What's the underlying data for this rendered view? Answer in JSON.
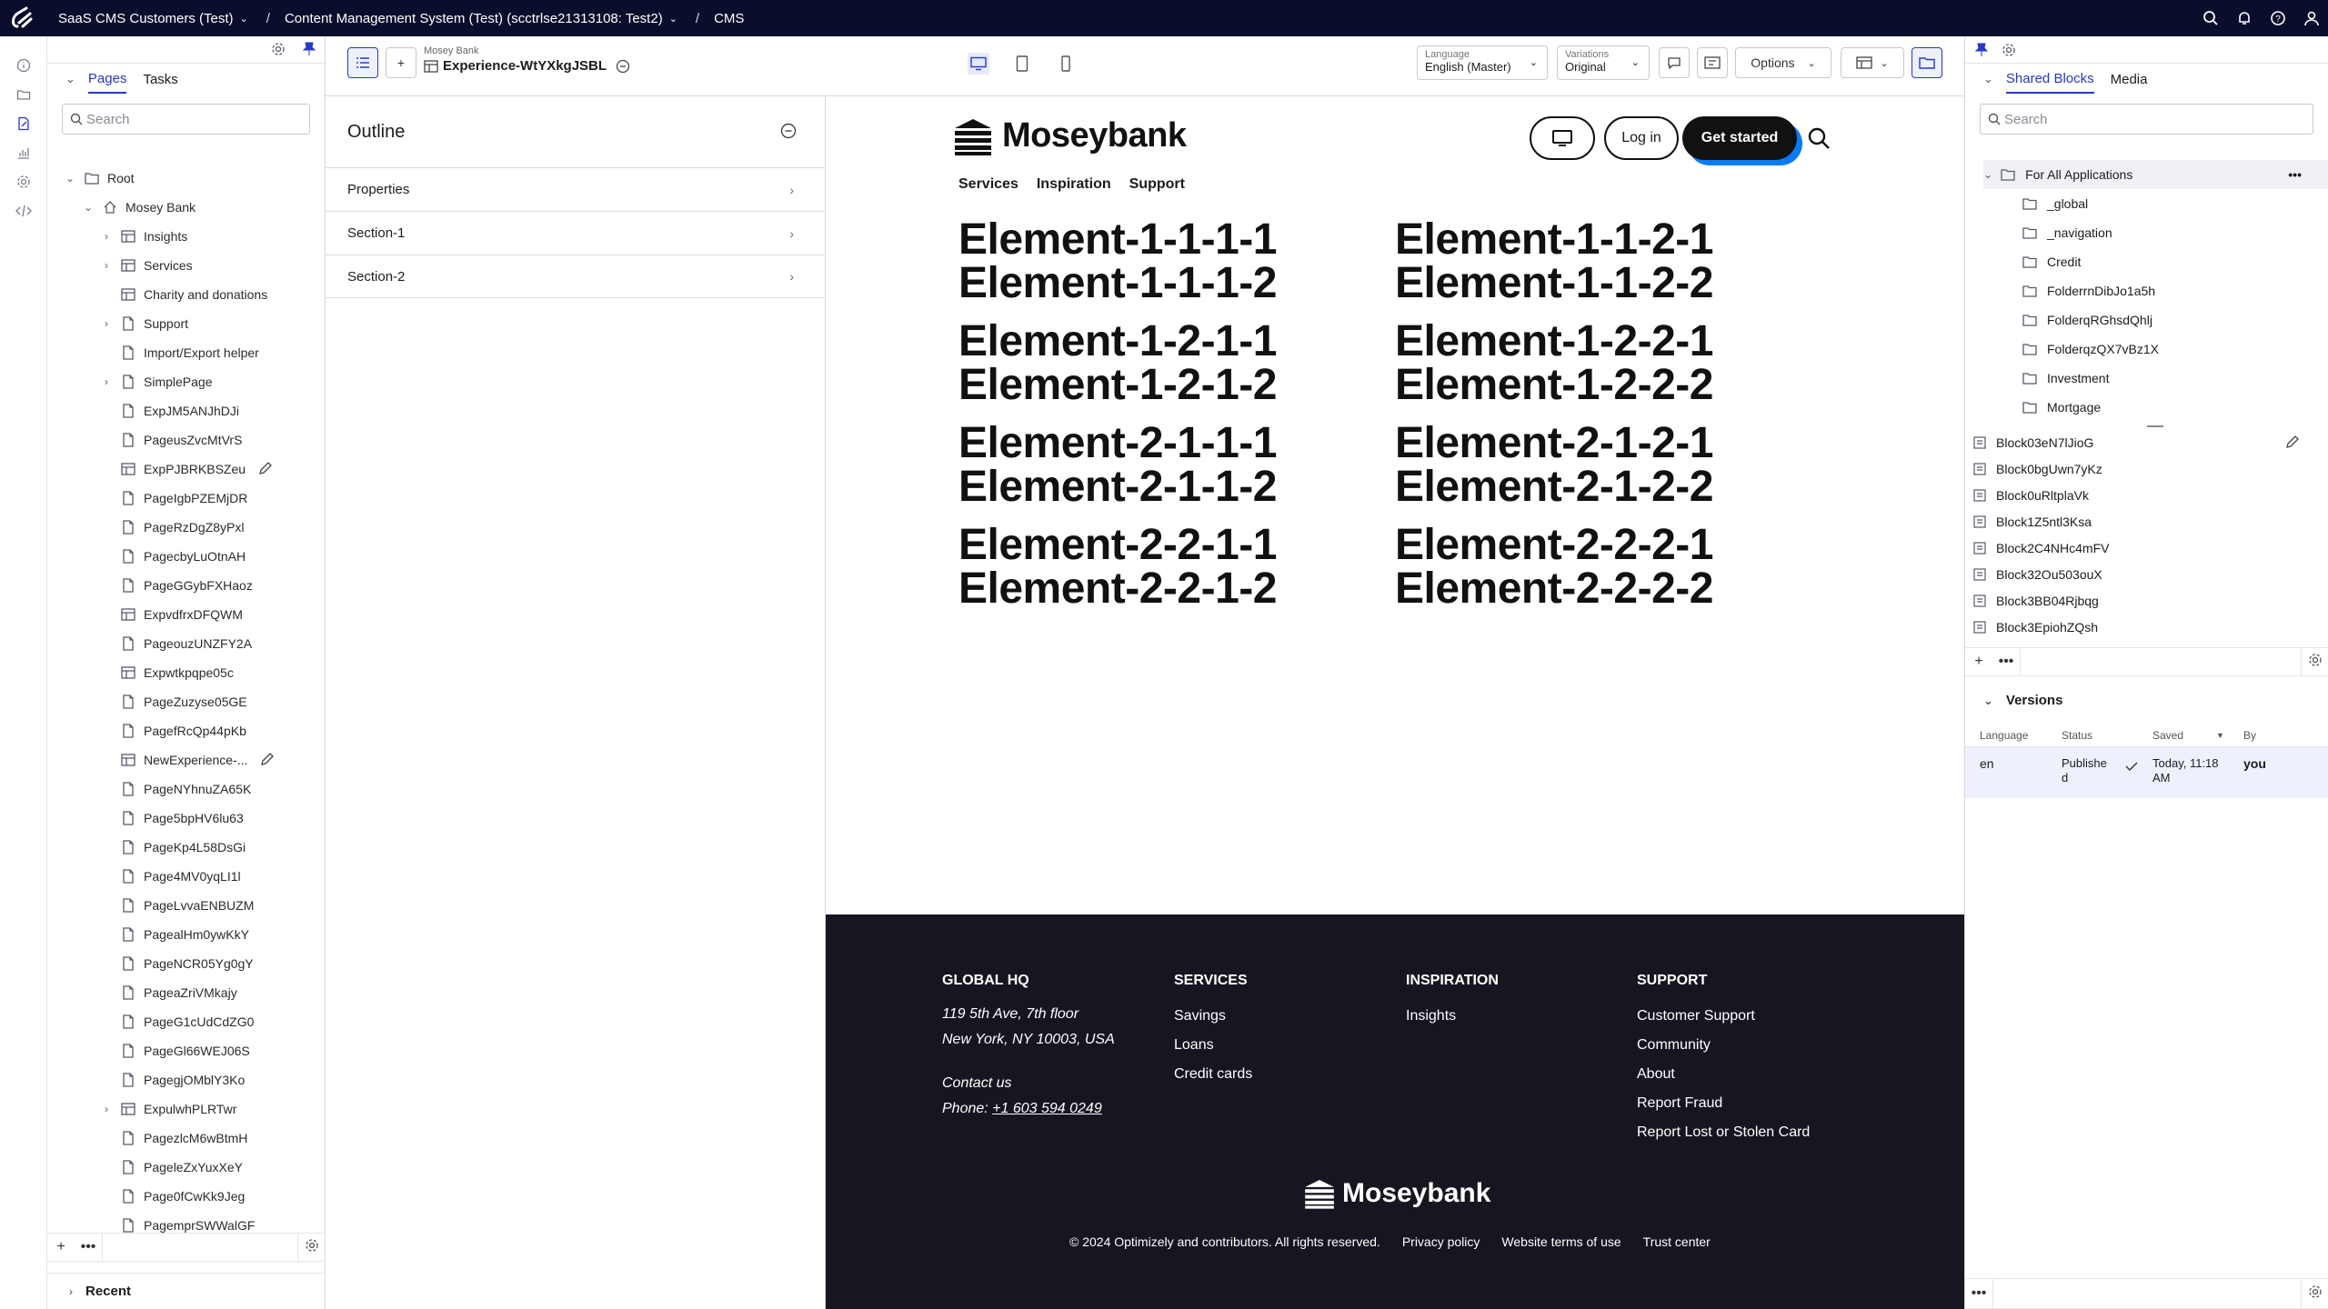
{
  "topbar": {
    "crumbs": [
      "SaaS CMS Customers (Test)",
      "Content Management System (Test) (scctrlse21313108: Test2)",
      "CMS"
    ],
    "icons": [
      "search-icon",
      "bell-icon",
      "help-icon",
      "user-icon"
    ]
  },
  "rail": {
    "icons": [
      "info-icon",
      "folders-icon",
      "edit-page-icon",
      "reports-icon",
      "settings-icon",
      "code-icon"
    ],
    "active": "edit-page-icon"
  },
  "tree": {
    "tabs": [
      "Pages",
      "Tasks"
    ],
    "search_placeholder": "Search",
    "nodes": [
      {
        "label": "Root",
        "level": 0,
        "chevron": "down",
        "icon": "folder"
      },
      {
        "label": "Mosey Bank",
        "level": 1,
        "chevron": "down",
        "icon": "home"
      },
      {
        "label": "Insights",
        "level": 2,
        "chevron": "right",
        "icon": "experience"
      },
      {
        "label": "Services",
        "level": 2,
        "chevron": "right",
        "icon": "experience"
      },
      {
        "label": "Charity and donations",
        "level": 2,
        "chevron": "",
        "icon": "experience"
      },
      {
        "label": "Support",
        "level": 2,
        "chevron": "right",
        "icon": "page"
      },
      {
        "label": "Import/Export helper",
        "level": 2,
        "chevron": "",
        "icon": "page"
      },
      {
        "label": "SimplePage",
        "level": 2,
        "chevron": "right",
        "icon": "page"
      },
      {
        "label": "ExpJM5ANJhDJi",
        "level": 2,
        "chevron": "",
        "icon": "page"
      },
      {
        "label": "PageusZvcMtVrS",
        "level": 2,
        "chevron": "",
        "icon": "page"
      },
      {
        "label": "ExpPJBRKBSZeu",
        "level": 2,
        "chevron": "",
        "icon": "experience",
        "edit": true
      },
      {
        "label": "PageIgbPZEMjDR",
        "level": 2,
        "chevron": "",
        "icon": "page"
      },
      {
        "label": "PageRzDgZ8yPxl",
        "level": 2,
        "chevron": "",
        "icon": "page"
      },
      {
        "label": "PagecbyLuOtnAH",
        "level": 2,
        "chevron": "",
        "icon": "page"
      },
      {
        "label": "PageGGybFXHaoz",
        "level": 2,
        "chevron": "",
        "icon": "page"
      },
      {
        "label": "ExpvdfrxDFQWM",
        "level": 2,
        "chevron": "",
        "icon": "experience"
      },
      {
        "label": "PageouzUNZFY2A",
        "level": 2,
        "chevron": "",
        "icon": "page"
      },
      {
        "label": "Expwtkpqpe05c",
        "level": 2,
        "chevron": "",
        "icon": "experience"
      },
      {
        "label": "PageZuzyse05GE",
        "level": 2,
        "chevron": "",
        "icon": "page"
      },
      {
        "label": "PagefRcQp44pKb",
        "level": 2,
        "chevron": "",
        "icon": "page"
      },
      {
        "label": "NewExperience-...",
        "level": 2,
        "chevron": "",
        "icon": "experience",
        "edit": true
      },
      {
        "label": "PageNYhnuZA65K",
        "level": 2,
        "chevron": "",
        "icon": "page"
      },
      {
        "label": "Page5bpHV6lu63",
        "level": 2,
        "chevron": "",
        "icon": "page"
      },
      {
        "label": "PageKp4L58DsGi",
        "level": 2,
        "chevron": "",
        "icon": "page"
      },
      {
        "label": "Page4MV0yqLI1l",
        "level": 2,
        "chevron": "",
        "icon": "page"
      },
      {
        "label": "PageLvvaENBUZM",
        "level": 2,
        "chevron": "",
        "icon": "page"
      },
      {
        "label": "PagealHm0ywKkY",
        "level": 2,
        "chevron": "",
        "icon": "page"
      },
      {
        "label": "PageNCR05Yg0gY",
        "level": 2,
        "chevron": "",
        "icon": "page"
      },
      {
        "label": "PageaZriVMkajy",
        "level": 2,
        "chevron": "",
        "icon": "page"
      },
      {
        "label": "PageG1cUdCdZG0",
        "level": 2,
        "chevron": "",
        "icon": "page"
      },
      {
        "label": "PageGl66WEJ06S",
        "level": 2,
        "chevron": "",
        "icon": "page"
      },
      {
        "label": "PagegjOMblY3Ko",
        "level": 2,
        "chevron": "",
        "icon": "page"
      },
      {
        "label": "ExpulwhPLRTwr",
        "level": 2,
        "chevron": "right",
        "icon": "experience"
      },
      {
        "label": "PagezlcM6wBtmH",
        "level": 2,
        "chevron": "",
        "icon": "page"
      },
      {
        "label": "PageleZxYuxXeY",
        "level": 2,
        "chevron": "",
        "icon": "page"
      },
      {
        "label": "Page0fCwKk9Jeg",
        "level": 2,
        "chevron": "",
        "icon": "page"
      },
      {
        "label": "PagemprSWWalGF",
        "level": 2,
        "chevron": "",
        "icon": "page"
      }
    ],
    "recent_label": "Recent"
  },
  "editor": {
    "context_parent": "Mosey Bank",
    "context_title": "Experience-WtYXkgJSBL",
    "language": {
      "label": "Language",
      "value": "English (Master)"
    },
    "variations": {
      "label": "Variations",
      "value": "Original"
    },
    "options_label": "Options"
  },
  "outline": {
    "title": "Outline",
    "rows": [
      "Properties",
      "Section-1",
      "Section-2"
    ]
  },
  "preview": {
    "brand": "Moseybank",
    "nav": [
      "Services",
      "Inspiration",
      "Support"
    ],
    "login_label": "Log in",
    "start_label": "Get started",
    "elements": [
      [
        "Element-1-1-1-1",
        "Element-1-1-1-2",
        "Element-1-1-2-1",
        "Element-1-1-2-2"
      ],
      [
        "Element-1-2-1-1",
        "Element-1-2-1-2",
        "Element-1-2-2-1",
        "Element-1-2-2-2"
      ],
      [
        "Element-2-1-1-1",
        "Element-2-1-1-2",
        "Element-2-1-2-1",
        "Element-2-1-2-2"
      ],
      [
        "Element-2-2-1-1",
        "Element-2-2-1-2",
        "Element-2-2-2-1",
        "Element-2-2-2-2"
      ]
    ],
    "footer": {
      "hq": {
        "heading": "GLOBAL HQ",
        "address1": "119 5th Ave, 7th floor",
        "address2": "New York, NY 10003, USA",
        "contact": "Contact us",
        "phone_prefix": "Phone: ",
        "phone": "+1 603 594 0249"
      },
      "services": {
        "heading": "SERVICES",
        "items": [
          "Savings",
          "Loans",
          "Credit cards"
        ]
      },
      "inspiration": {
        "heading": "INSPIRATION",
        "items": [
          "Insights"
        ]
      },
      "support": {
        "heading": "SUPPORT",
        "items": [
          "Customer Support",
          "Community",
          "About",
          "Report Fraud",
          "Report Lost or Stolen Card"
        ]
      },
      "brand": "Moseybank",
      "legal": [
        "© 2024 Optimizely and contributors. All rights reserved.",
        "Privacy policy",
        "Website terms of use",
        "Trust center"
      ]
    }
  },
  "right": {
    "tabs": [
      "Shared Blocks",
      "Media"
    ],
    "search_placeholder": "Search",
    "root_folder": "For All Applications",
    "folders": [
      "_global",
      "_navigation",
      "Credit",
      "FolderrnDibJo1a5h",
      "FolderqRGhsdQhlj",
      "FolderqzQX7vBz1X",
      "Investment",
      "Mortgage"
    ],
    "blocks": [
      "Block03eN7lJioG",
      "Block0bgUwn7yKz",
      "Block0uRltplaVk",
      "Block1Z5ntl3Ksa",
      "Block2C4NHc4mFV",
      "Block32Ou503ouX",
      "Block3BB04Rjbqg",
      "Block3EpiohZQsh"
    ],
    "versions": {
      "title": "Versions",
      "columns": [
        "Language",
        "Status",
        "Saved",
        "By"
      ],
      "row": {
        "language": "en",
        "status_line1": "Publishe",
        "status_line2": "d",
        "saved_line1": "Today, 11:18",
        "saved_line2": "AM",
        "by": "you"
      }
    }
  },
  "colors": {
    "accent": "#243ac4",
    "topbar": "#0b0d2c",
    "footer": "#151620",
    "start_shadow": "#0a7bf2"
  }
}
